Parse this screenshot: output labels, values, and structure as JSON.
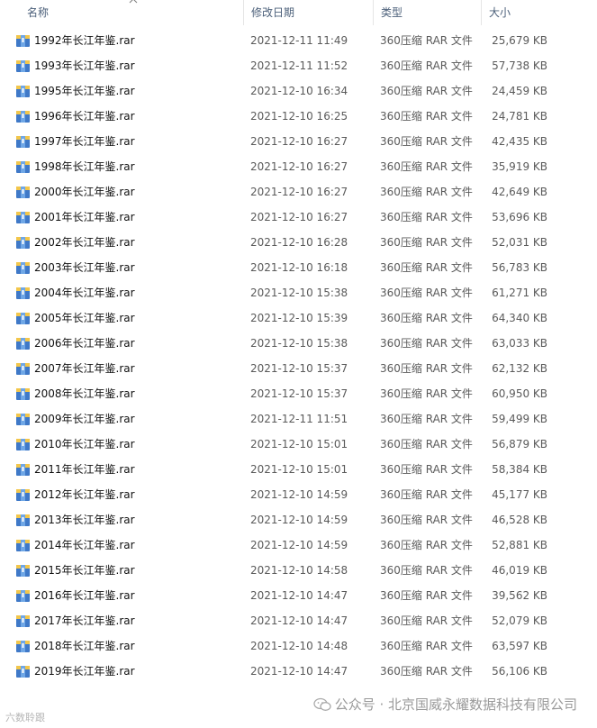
{
  "columns": {
    "name": "名称",
    "date": "修改日期",
    "type": "类型",
    "size": "大小"
  },
  "files": [
    {
      "name": "1992年长江年鉴.rar",
      "date": "2021-12-11 11:49",
      "type": "360压缩 RAR 文件",
      "size": "25,679 KB"
    },
    {
      "name": "1993年长江年鉴.rar",
      "date": "2021-12-11 11:52",
      "type": "360压缩 RAR 文件",
      "size": "57,738 KB"
    },
    {
      "name": "1995年长江年鉴.rar",
      "date": "2021-12-10 16:34",
      "type": "360压缩 RAR 文件",
      "size": "24,459 KB"
    },
    {
      "name": "1996年长江年鉴.rar",
      "date": "2021-12-10 16:25",
      "type": "360压缩 RAR 文件",
      "size": "24,781 KB"
    },
    {
      "name": "1997年长江年鉴.rar",
      "date": "2021-12-10 16:27",
      "type": "360压缩 RAR 文件",
      "size": "42,435 KB"
    },
    {
      "name": "1998年长江年鉴.rar",
      "date": "2021-12-10 16:27",
      "type": "360压缩 RAR 文件",
      "size": "35,919 KB"
    },
    {
      "name": "2000年长江年鉴.rar",
      "date": "2021-12-10 16:27",
      "type": "360压缩 RAR 文件",
      "size": "42,649 KB"
    },
    {
      "name": "2001年长江年鉴.rar",
      "date": "2021-12-10 16:27",
      "type": "360压缩 RAR 文件",
      "size": "53,696 KB"
    },
    {
      "name": "2002年长江年鉴.rar",
      "date": "2021-12-10 16:28",
      "type": "360压缩 RAR 文件",
      "size": "52,031 KB"
    },
    {
      "name": "2003年长江年鉴.rar",
      "date": "2021-12-10 16:18",
      "type": "360压缩 RAR 文件",
      "size": "56,783 KB"
    },
    {
      "name": "2004年长江年鉴.rar",
      "date": "2021-12-10 15:38",
      "type": "360压缩 RAR 文件",
      "size": "61,271 KB"
    },
    {
      "name": "2005年长江年鉴.rar",
      "date": "2021-12-10 15:39",
      "type": "360压缩 RAR 文件",
      "size": "64,340 KB"
    },
    {
      "name": "2006年长江年鉴.rar",
      "date": "2021-12-10 15:38",
      "type": "360压缩 RAR 文件",
      "size": "63,033 KB"
    },
    {
      "name": "2007年长江年鉴.rar",
      "date": "2021-12-10 15:37",
      "type": "360压缩 RAR 文件",
      "size": "62,132 KB"
    },
    {
      "name": "2008年长江年鉴.rar",
      "date": "2021-12-10 15:37",
      "type": "360压缩 RAR 文件",
      "size": "60,950 KB"
    },
    {
      "name": "2009年长江年鉴.rar",
      "date": "2021-12-11 11:51",
      "type": "360压缩 RAR 文件",
      "size": "59,499 KB"
    },
    {
      "name": "2010年长江年鉴.rar",
      "date": "2021-12-10 15:01",
      "type": "360压缩 RAR 文件",
      "size": "56,879 KB"
    },
    {
      "name": "2011年长江年鉴.rar",
      "date": "2021-12-10 15:01",
      "type": "360压缩 RAR 文件",
      "size": "58,384 KB"
    },
    {
      "name": "2012年长江年鉴.rar",
      "date": "2021-12-10 14:59",
      "type": "360压缩 RAR 文件",
      "size": "45,177 KB"
    },
    {
      "name": "2013年长江年鉴.rar",
      "date": "2021-12-10 14:59",
      "type": "360压缩 RAR 文件",
      "size": "46,528 KB"
    },
    {
      "name": "2014年长江年鉴.rar",
      "date": "2021-12-10 14:59",
      "type": "360压缩 RAR 文件",
      "size": "52,881 KB"
    },
    {
      "name": "2015年长江年鉴.rar",
      "date": "2021-12-10 14:58",
      "type": "360压缩 RAR 文件",
      "size": "46,019 KB"
    },
    {
      "name": "2016年长江年鉴.rar",
      "date": "2021-12-10 14:47",
      "type": "360压缩 RAR 文件",
      "size": "39,562 KB"
    },
    {
      "name": "2017年长江年鉴.rar",
      "date": "2021-12-10 14:47",
      "type": "360压缩 RAR 文件",
      "size": "52,079 KB"
    },
    {
      "name": "2018年长江年鉴.rar",
      "date": "2021-12-10 14:48",
      "type": "360压缩 RAR 文件",
      "size": "63,597 KB"
    },
    {
      "name": "2019年长江年鉴.rar",
      "date": "2021-12-10 14:47",
      "type": "360压缩 RAR 文件",
      "size": "56,106 KB"
    }
  ],
  "file_icon": "rar-archive-icon",
  "watermark": {
    "text": "公众号 · 北京国威永耀数据科技有限公司",
    "corner_text": "六数聆跟",
    "icon": "wechat-icon"
  }
}
